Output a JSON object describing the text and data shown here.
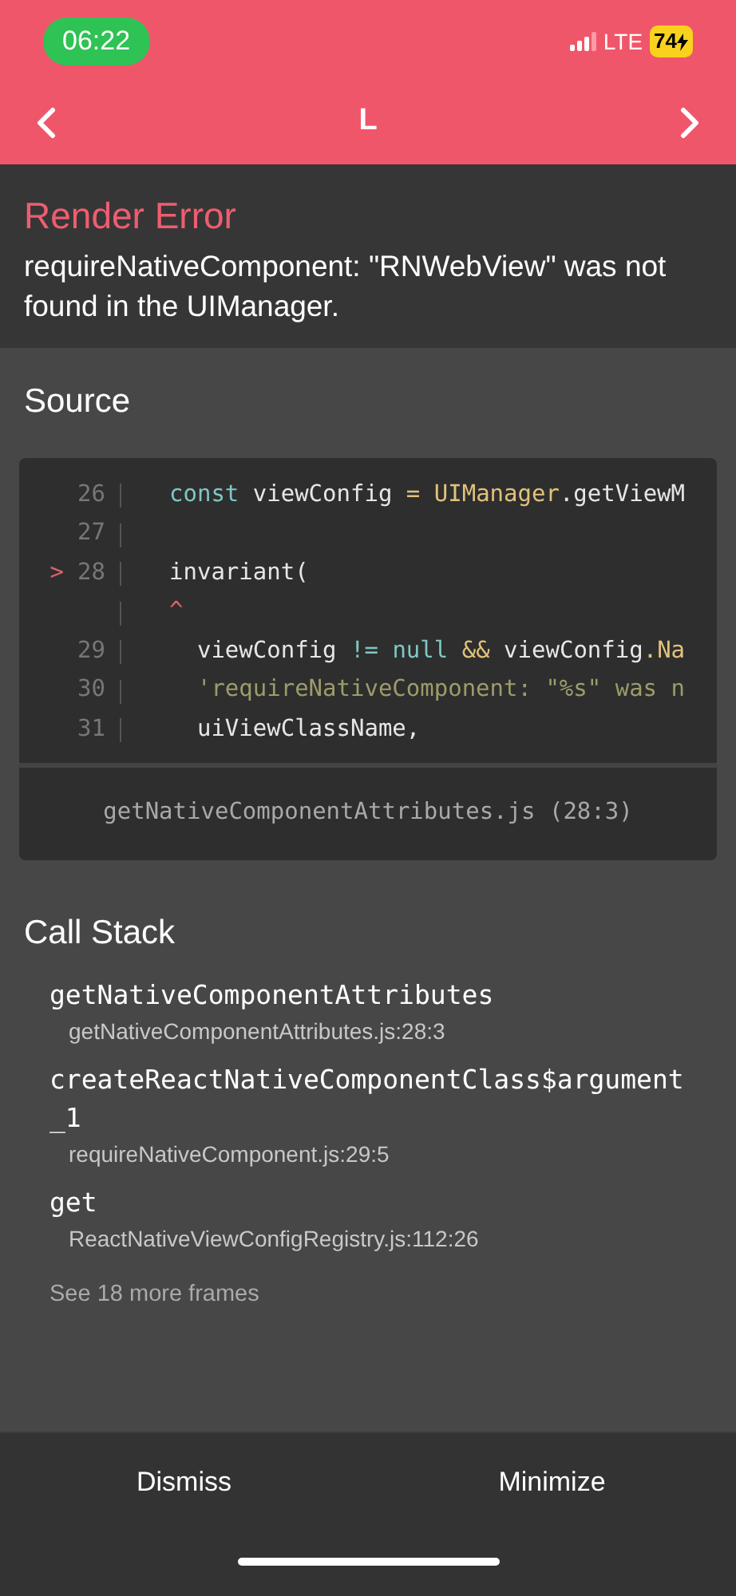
{
  "status_bar": {
    "time": "06:22",
    "network": "LTE",
    "battery": "74"
  },
  "nav": {
    "title": "L"
  },
  "error": {
    "title": "Render Error",
    "message": "requireNativeComponent: \"RNWebView\" was not found in the UIManager."
  },
  "source": {
    "title": "Source",
    "lines": [
      {
        "number": "26",
        "tokens": [
          {
            "kind": "keyword",
            "text": "const"
          },
          {
            "kind": "plain",
            "text": " viewConfig "
          },
          {
            "kind": "member",
            "text": "= UIManager"
          },
          {
            "kind": "plain",
            "text": ".getViewM"
          }
        ]
      },
      {
        "number": "27"
      },
      {
        "number": "28",
        "marker": ">",
        "tokens": [
          {
            "kind": "plain",
            "text": "invariant("
          }
        ]
      },
      {
        "tokens": [
          {
            "kind": "caret",
            "text": "^"
          }
        ]
      },
      {
        "number": "29",
        "tokens": [
          {
            "kind": "plain",
            "text": "  viewConfig "
          },
          {
            "kind": "keyword",
            "text": "!= null"
          },
          {
            "kind": "member",
            "text": " &&"
          },
          {
            "kind": "plain",
            "text": " viewConfig"
          },
          {
            "kind": "member",
            "text": ".Na"
          }
        ]
      },
      {
        "number": "30",
        "tokens": [
          {
            "kind": "string",
            "text": "  'requireNativeComponent: \"%s\" was n"
          }
        ]
      },
      {
        "number": "31",
        "tokens": [
          {
            "kind": "plain",
            "text": "  uiViewClassName,"
          }
        ]
      }
    ],
    "file": "getNativeComponentAttributes.js (28:3)"
  },
  "call_stack": {
    "title": "Call Stack",
    "frames": [
      {
        "name": "getNativeComponentAttributes",
        "location": "getNativeComponentAttributes.js:28:3"
      },
      {
        "name": "createReactNativeComponentClass$argument_1",
        "location": "requireNativeComponent.js:29:5"
      },
      {
        "name": "get",
        "location": "ReactNativeViewConfigRegistry.js:112:26"
      }
    ],
    "more": "See 18 more frames"
  },
  "buttons": [
    "Dismiss",
    "Minimize"
  ]
}
